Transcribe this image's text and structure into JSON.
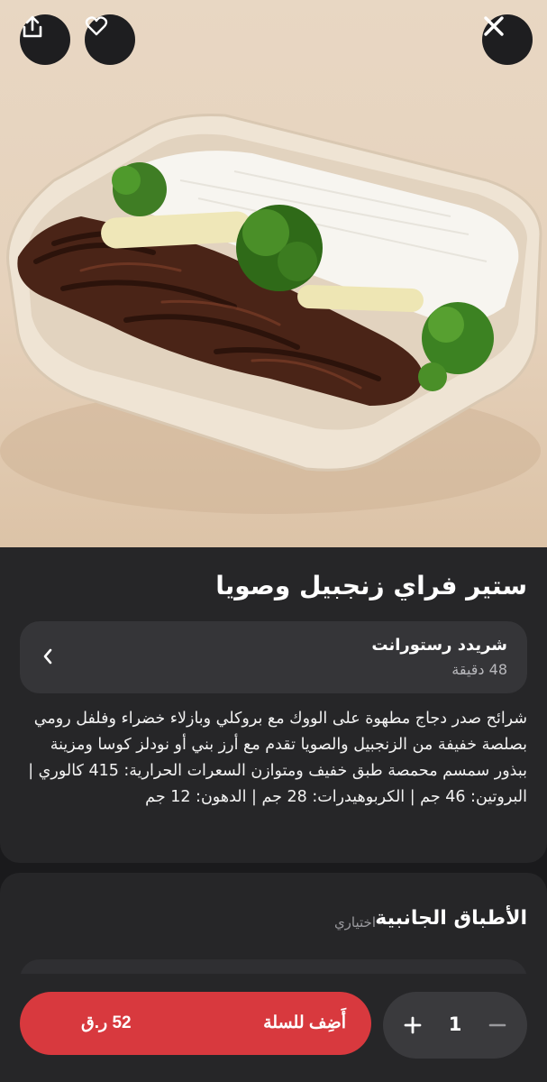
{
  "header": {
    "share_icon": "share-icon",
    "favorite_icon": "heart-icon",
    "close_icon": "close-icon"
  },
  "dish": {
    "title": "ستير فراي زنجبيل وصويا",
    "description": "شرائح صدر دجاج مطهوة على الووك مع بروكلي وبازلاء خضراء وفلفل رومي بصلصة خفيفة من الزنجبيل والصويا تقدم مع أرز بني أو نودلز كوسا ومزينة ببذور سمسم محمصة طبق خفيف ومتوازن السعرات الحرارية: 415 كالوري | البروتين: 46 جم | الكربوهيدرات: 28 جم | الدهون: 12 جم"
  },
  "restaurant": {
    "name": "شريدد رستورانت",
    "delivery_time": "48 دقيقة",
    "chevron_icon": "chevron-left-icon"
  },
  "side_dishes": {
    "title": "الأطباق الجانبية",
    "optional_label": "اختياري"
  },
  "cart": {
    "add_label": "أَضِف للسلة",
    "price": "52 ر.ق",
    "quantity": "1",
    "accent": "#d8393e"
  }
}
